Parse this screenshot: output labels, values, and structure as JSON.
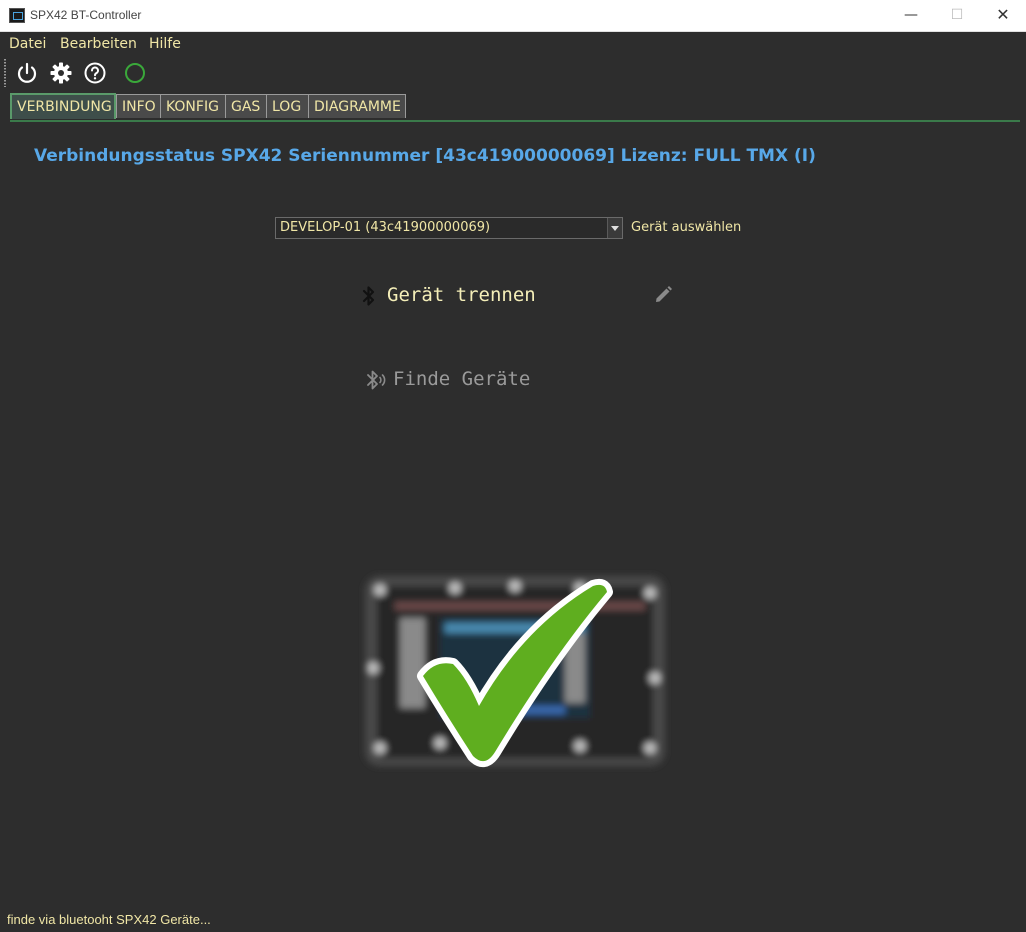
{
  "window": {
    "title": "SPX42 BT-Controller",
    "controls": {
      "minimize": "—",
      "maximize": "☐",
      "close": "✕"
    }
  },
  "menu": [
    {
      "label": "Datei"
    },
    {
      "label": "Bearbeiten"
    },
    {
      "label": "Hilfe"
    }
  ],
  "toolbar": {
    "icons": [
      "power-icon",
      "gear-icon",
      "help-icon",
      "connection-status-indicator"
    ],
    "status_color": "#3aa83a"
  },
  "tabs": [
    {
      "label": "VERBINDUNG",
      "active": true
    },
    {
      "label": "INFO"
    },
    {
      "label": "KONFIG"
    },
    {
      "label": "GAS"
    },
    {
      "label": "LOG"
    },
    {
      "label": "DIAGRAMME"
    }
  ],
  "main": {
    "heading": "Verbindungsstatus SPX42 Seriennummer [43c41900000069] Lizenz: FULL TMX (I)",
    "device_select": {
      "value": "DEVELOP-01 (43c41900000069)",
      "label": "Gerät auswählen"
    },
    "disconnect_label": "Gerät trennen",
    "find_label": "Finde Geräte"
  },
  "status": {
    "text": "finde via bluetooht SPX42 Geräte..."
  },
  "colors": {
    "background": "#2d2d2d",
    "text": "#f0e6a6",
    "heading": "#58a8e8",
    "accent": "#5a9a6a"
  }
}
